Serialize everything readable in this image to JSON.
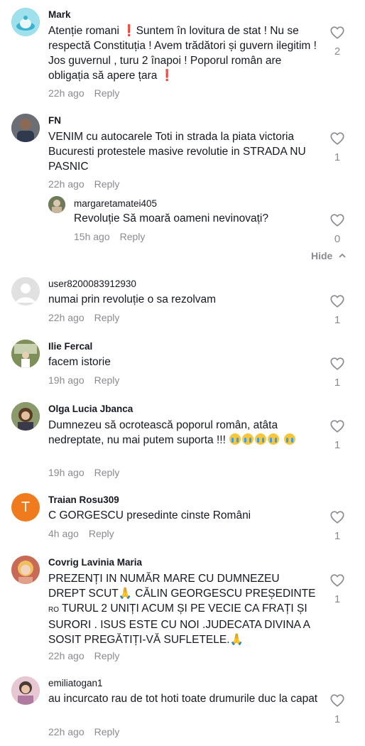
{
  "icons": {
    "like": "heart-outline-icon",
    "collapse": "chevron-up-icon",
    "flag": "red-exclamation-icon",
    "cry": "crying-face-icon",
    "pray": "folded-hands-icon"
  },
  "colors": {
    "text": "#161823",
    "muted": "#8a8b91",
    "orange_avatar": "#f07a1e"
  },
  "comments": [
    {
      "username": "Mark",
      "text_parts": [
        "Atenție romani ",
        "Suntem în lovitura de stat ! Nu se respectă Constituția ! Avem trădători și guvern ilegitim ! Jos guvernul , turu 2 înapoi ! Poporul român are obligația să apere țara "
      ],
      "time": "22h ago",
      "reply": "Reply",
      "likes": "2"
    },
    {
      "username": "FN",
      "text": "VENIM cu autocarele Toti in strada la piata victoria Bucuresti protestele masive revolutie in STRADA NU PASNIC",
      "time": "22h ago",
      "reply": "Reply",
      "likes": "1"
    },
    {
      "username": "margaretamatei405",
      "text": "Revoluție Să moară oameni nevinovați?",
      "time": "15h ago",
      "reply": "Reply",
      "likes": "0"
    },
    {
      "username": "user8200083912930",
      "text": "numai prin revoluție o sa rezolvam",
      "time": "22h ago",
      "reply": "Reply",
      "likes": "1"
    },
    {
      "username": "Ilie Fercal",
      "text": "facem istorie",
      "time": "19h ago",
      "reply": "Reply",
      "likes": "1"
    },
    {
      "username": "Olga Lucia Jbanca",
      "text": "Dumnezeu să ocrotească poporul român, atâta nedreptate, nu mai putem suporta !!! ",
      "time": "19h ago",
      "reply": "Reply",
      "likes": "1"
    },
    {
      "username": "Traian Rosu309",
      "avatar_letter": "T",
      "text": "C GORGESCU presedinte cinste Români",
      "time": "4h ago",
      "reply": "Reply",
      "likes": "1"
    },
    {
      "username": "Covrig Lavinia Maria",
      "text_parts": [
        "PREZENȚI IN NUMĂR MARE CU DUMNEZEU DREPT SCUT",
        " CĂLIN GEORGESCU PREȘEDINTE ",
        "RO",
        " TURUL 2 UNIȚI ACUM ȘI PE VECIE CA FRAȚI ȘI SURORI . ISUS ESTE CU NOI .JUDECATA DIVINA A SOSIT PREGĂTIȚI-VĂ SUFLETELE."
      ],
      "time": "22h ago",
      "reply": "Reply",
      "likes": "1"
    },
    {
      "username": "emiliatogan1",
      "text": "au incurcato rau de tot hoti toate drumurile duc la capat",
      "time": "22h ago",
      "reply": "Reply",
      "likes": "1"
    }
  ],
  "hide_label": "Hide"
}
